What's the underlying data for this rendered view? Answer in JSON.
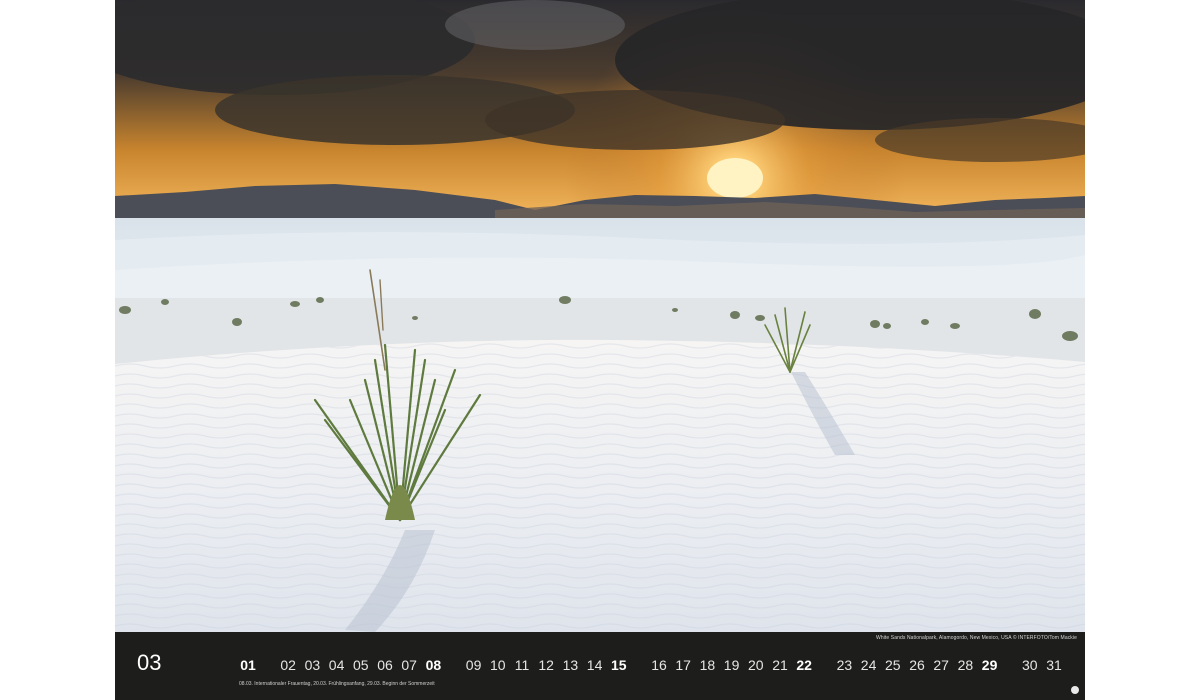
{
  "photo": {
    "description_icon": "white-sands-landscape-photo"
  },
  "bar": {
    "month": "03",
    "credit": "White Sands Nationalpark, Alamogordo, New Mexico, USA © INTERFOTO/Tom Mackie",
    "holidays": "08.03. Internationaler Frauentag, 20.03. Frühlingsanfang, 29.03. Beginn der Sommerzeit",
    "days": [
      "01",
      "02",
      "03",
      "04",
      "05",
      "06",
      "07",
      "08",
      "09",
      "10",
      "11",
      "12",
      "13",
      "14",
      "15",
      "16",
      "17",
      "18",
      "19",
      "20",
      "21",
      "22",
      "23",
      "24",
      "25",
      "26",
      "27",
      "28",
      "29",
      "30",
      "31"
    ],
    "bold_days": [
      "01",
      "08",
      "15",
      "22",
      "29"
    ]
  },
  "colors": {
    "bar_background": "#1d1d1b",
    "sun": "#ffd27a",
    "sand": "#eef2f6"
  }
}
